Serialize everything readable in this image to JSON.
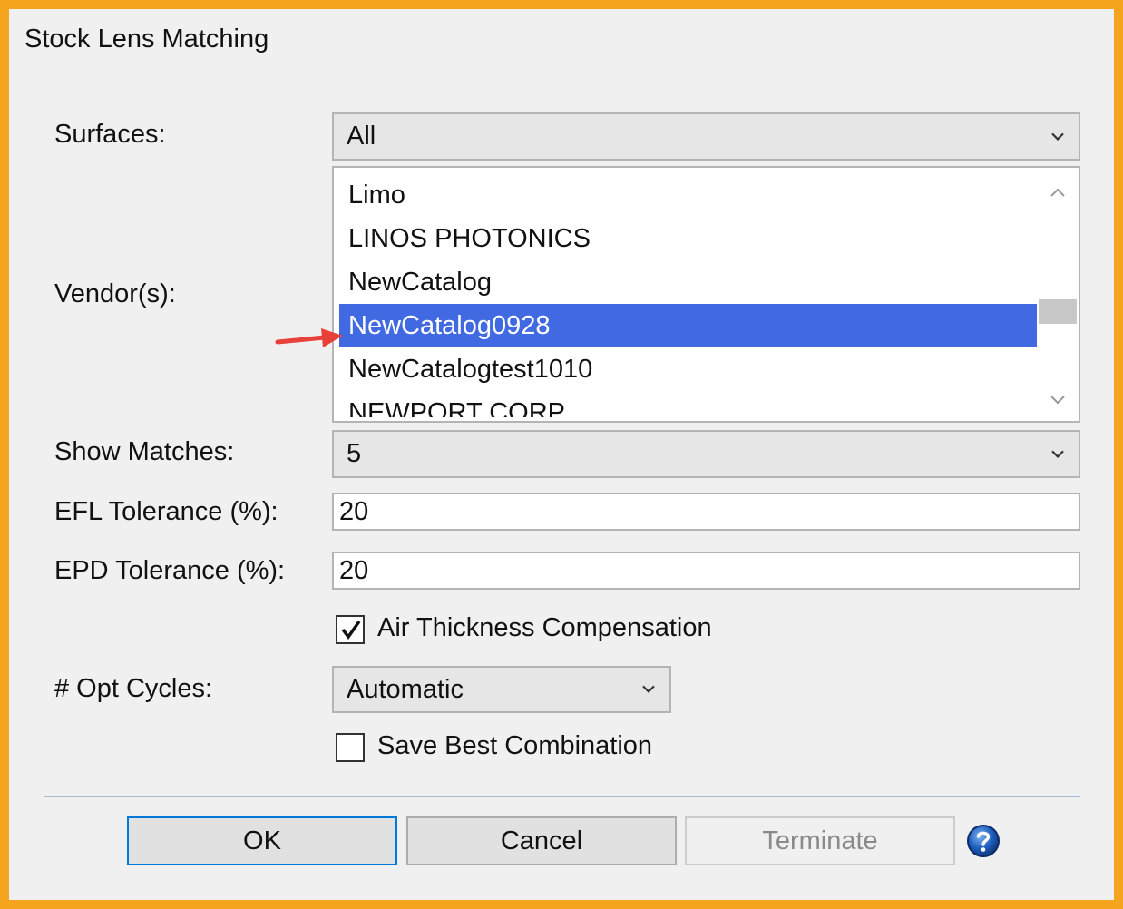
{
  "dialog": {
    "title": "Stock Lens Matching"
  },
  "surfaces": {
    "label": "Surfaces:",
    "value": "All"
  },
  "vendors": {
    "label": "Vendor(s):",
    "items": [
      "Limo",
      "LINOS PHOTONICS",
      "NewCatalog",
      "NewCatalog0928",
      "NewCatalogtest1010",
      "NEWPORT CORP"
    ],
    "selected": "NewCatalog0928"
  },
  "show_matches": {
    "label": "Show Matches:",
    "value": "5"
  },
  "efl_tolerance": {
    "label": "EFL Tolerance (%):",
    "value": "20"
  },
  "epd_tolerance": {
    "label": "EPD Tolerance (%):",
    "value": "20"
  },
  "air_thickness": {
    "label": "Air Thickness Compensation",
    "checked": true
  },
  "opt_cycles": {
    "label": "# Opt Cycles:",
    "value": "Automatic"
  },
  "save_best": {
    "label": "Save Best Combination",
    "checked": false
  },
  "buttons": {
    "ok": "OK",
    "cancel": "Cancel",
    "terminate": "Terminate",
    "help_icon": "help-icon"
  },
  "colors": {
    "selection": "#4169e1",
    "annotation_arrow": "#e8403a",
    "frame": "#f5a51d",
    "help_blue": "#1f5fbf"
  }
}
